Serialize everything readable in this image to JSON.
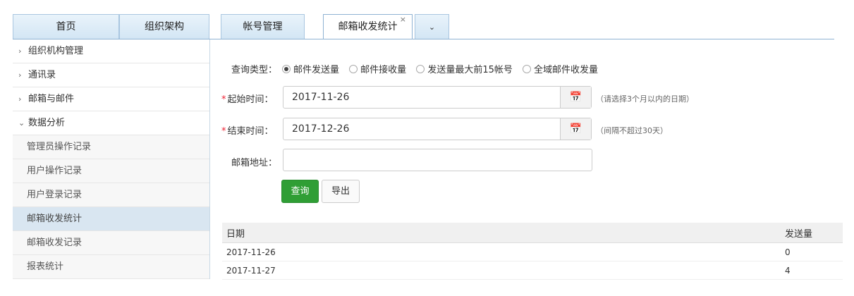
{
  "tabs": [
    {
      "label": "首页"
    },
    {
      "label": "组织架构"
    },
    {
      "label": "帐号管理"
    },
    {
      "label": "邮箱收发统计",
      "close": "×"
    }
  ],
  "tab_more": "⌄",
  "sidebar": {
    "items": [
      {
        "label": "组织机构管理",
        "chev": "›"
      },
      {
        "label": "通讯录",
        "chev": "›"
      },
      {
        "label": "邮箱与邮件",
        "chev": "›"
      },
      {
        "label": "数据分析",
        "chev": "⌄"
      },
      {
        "label": "管理员操作记录"
      },
      {
        "label": "用户操作记录"
      },
      {
        "label": "用户登录记录"
      },
      {
        "label": "邮箱收发统计"
      },
      {
        "label": "邮箱收发记录"
      },
      {
        "label": "报表统计"
      }
    ]
  },
  "form": {
    "query_type_label": "查询类型：",
    "options": [
      "邮件发送量",
      "邮件接收量",
      "发送量最大前15帐号",
      "全域邮件收发量"
    ],
    "selected_option": "邮件发送量",
    "start_label": "起始时间：",
    "start_value": "2017-11-26",
    "start_hint": "（请选择3个月以内的日期）",
    "end_label": "结束时间：",
    "end_value": "2017-12-26",
    "end_hint": "（间隔不超过30天）",
    "required_mark": "*",
    "email_label": "邮箱地址：",
    "email_value": "",
    "query_button": "查询",
    "export_button": "导出"
  },
  "table": {
    "headers": [
      "日期",
      "发送量"
    ],
    "rows": [
      [
        "2017-11-26",
        "0"
      ],
      [
        "2017-11-27",
        "4"
      ]
    ]
  },
  "colors": {
    "accent_green": "#2f9e35",
    "tab_border": "#8fb3d3",
    "required_red": "#e23"
  }
}
